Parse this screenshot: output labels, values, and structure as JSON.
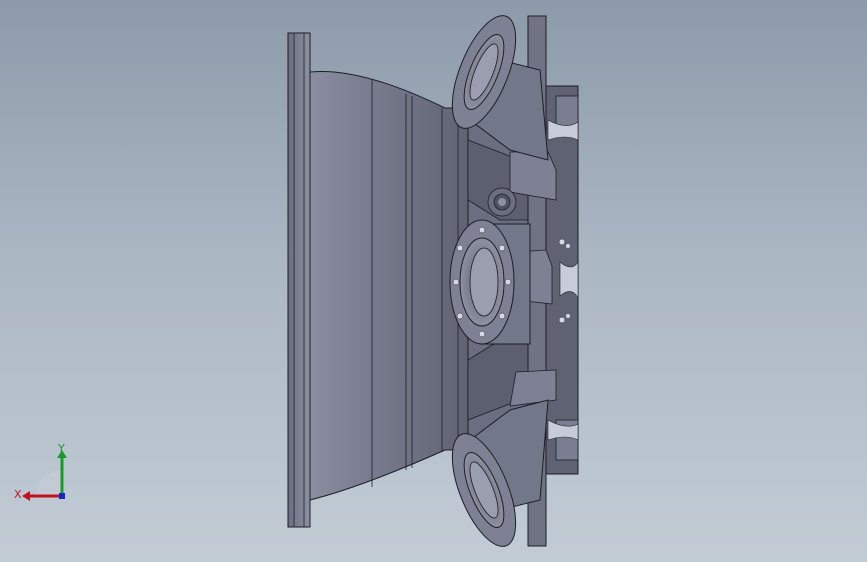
{
  "viewport": {
    "background_top": "#8c9aaa",
    "background_bottom": "#c3ccd5"
  },
  "model": {
    "body_color": "#6f7384",
    "shadow_color": "#4e5262",
    "highlight_color": "#9a9eae",
    "edge_color": "#1c1e26"
  },
  "triad": {
    "x_label": "X",
    "y_label": "Y",
    "x_color": "#c0141c",
    "y_color": "#1a9a2a",
    "z_color": "#1428c8"
  }
}
